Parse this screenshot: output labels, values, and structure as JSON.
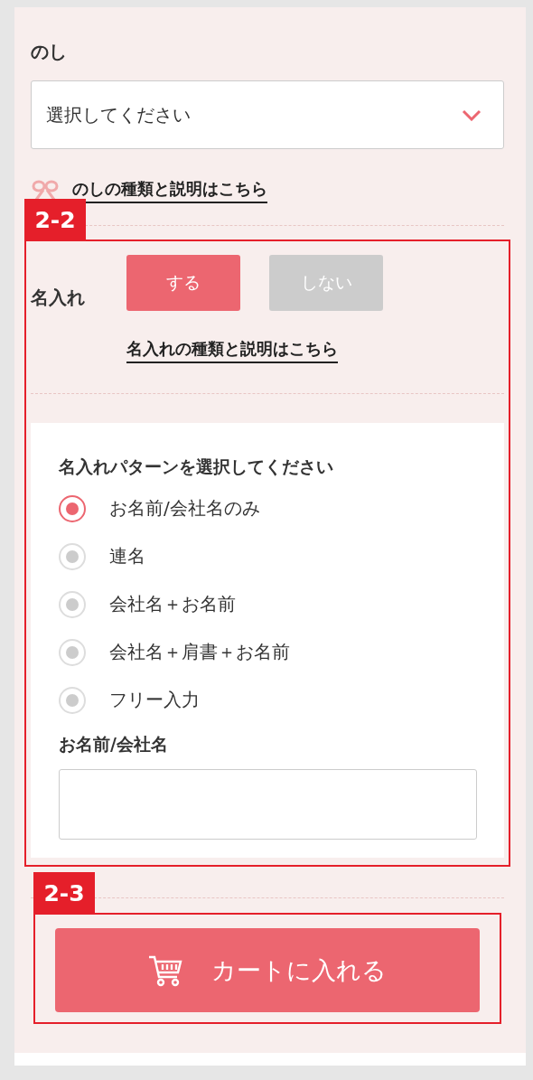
{
  "noshi": {
    "label": "のし",
    "select": {
      "value": "選択してください"
    },
    "link": "のしの種類と説明はこちら"
  },
  "naire": {
    "badge": "2-2",
    "label": "名入れ",
    "choices": [
      {
        "label": "する",
        "selected": true
      },
      {
        "label": "しない",
        "selected": false
      }
    ],
    "link": "名入れの種類と説明はこちら",
    "pattern": {
      "heading": "名入れパターンを選択してください",
      "options": [
        {
          "label": "お名前/会社名のみ",
          "selected": true
        },
        {
          "label": "連名",
          "selected": false
        },
        {
          "label": "会社名＋お名前",
          "selected": false
        },
        {
          "label": "会社名＋肩書＋お名前",
          "selected": false
        },
        {
          "label": "フリー入力",
          "selected": false
        }
      ]
    },
    "name_field": {
      "label": "お名前/会社名"
    }
  },
  "cart": {
    "badge": "2-3",
    "button": "カートに入れる"
  }
}
